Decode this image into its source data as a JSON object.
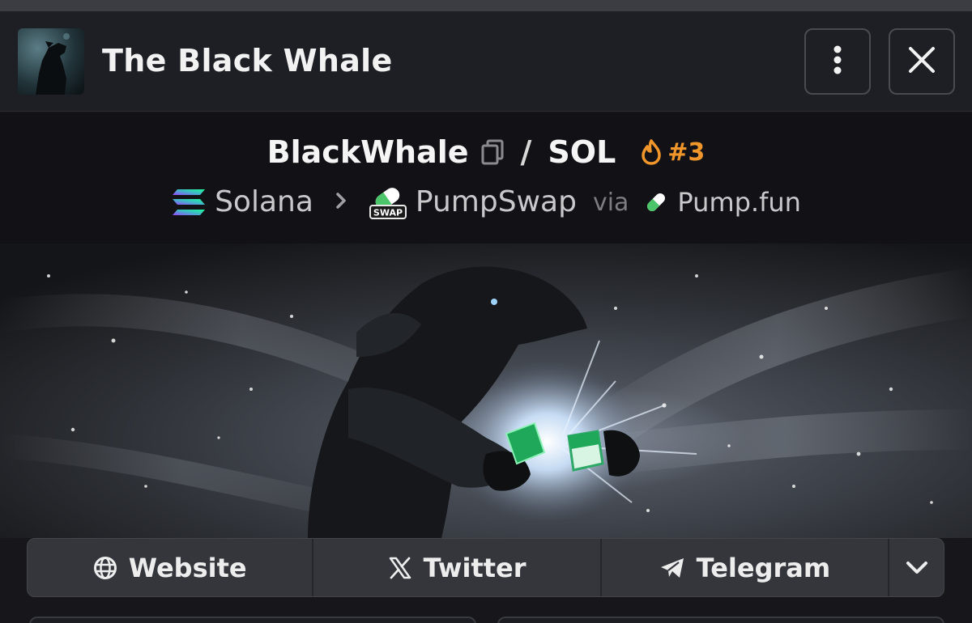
{
  "header": {
    "title": "The Black Whale",
    "icons": {
      "more": "more-vertical-icon",
      "close": "close-icon"
    }
  },
  "pair": {
    "base": "BlackWhale",
    "separator": "/",
    "quote": "SOL",
    "rank": "#3",
    "icons": {
      "copy": "copy-icon",
      "rank": "flame-icon"
    }
  },
  "breadcrumb": {
    "chain": "Solana",
    "dex": "PumpSwap",
    "dex_badge": "SWAP",
    "via": "via",
    "launchpad": "Pump.fun",
    "icons": {
      "chain": "solana-logo-icon",
      "dex": "pumpswap-logo-icon",
      "launchpad": "pill-icon",
      "separator": "chevron-right-icon"
    }
  },
  "banner": {
    "description": "artwork: armored black whale breaking a green pill"
  },
  "links": {
    "website": "Website",
    "twitter": "Twitter",
    "telegram": "Telegram",
    "icons": {
      "website": "globe-icon",
      "twitter": "x-logo-icon",
      "telegram": "telegram-plane-icon",
      "more": "chevron-down-icon"
    }
  },
  "colors": {
    "accent": "#f0962a",
    "background": "#121216",
    "header": "#1e1f25",
    "link_bar": "#35363c"
  }
}
